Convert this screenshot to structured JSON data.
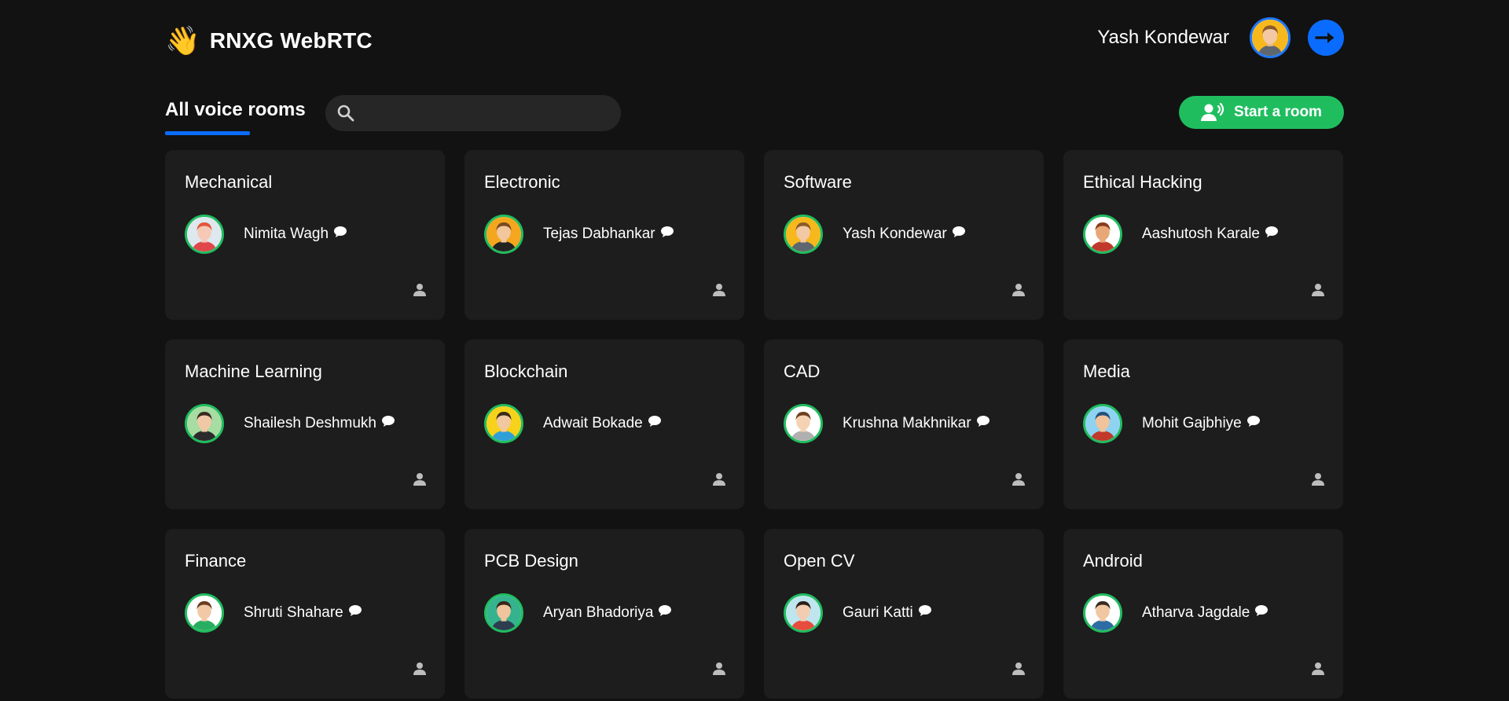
{
  "app": {
    "emoji": "👋",
    "title": "RNXG WebRTC"
  },
  "user": {
    "name": "Yash Kondewar",
    "avatar_icon": "user-avatar-icon"
  },
  "toolbar": {
    "tab_label": "All voice rooms",
    "search_placeholder": "",
    "start_room_label": "Start a room"
  },
  "colors": {
    "accent_blue": "#0a6cff",
    "accent_green": "#20bd5f",
    "card_bg": "#1d1d1d",
    "page_bg": "#121212"
  },
  "rooms": [
    {
      "topic": "Mechanical",
      "speaker": "Nimita Wagh",
      "avatar_bg": "#dfe8ee",
      "hair": "#e2553a",
      "skin": "#f6c9b6",
      "shirt": "#e0474b"
    },
    {
      "topic": "Electronic",
      "speaker": "Tejas Dabhankar",
      "avatar_bg": "#f4a71e",
      "hair": "#7a4a22",
      "skin": "#f2c79e",
      "shirt": "#222222"
    },
    {
      "topic": "Software",
      "speaker": "Yash Kondewar",
      "avatar_bg": "#f6b81c",
      "hair": "#8b5a2b",
      "skin": "#f2c9a4",
      "shirt": "#5e6670"
    },
    {
      "topic": "Ethical Hacking",
      "speaker": "Aashutosh Karale",
      "avatar_bg": "#ffffff",
      "hair": "#8a3b1c",
      "skin": "#e7a777",
      "shirt": "#c0392b"
    },
    {
      "topic": "Machine Learning",
      "speaker": "Shailesh Deshmukh",
      "avatar_bg": "#a7dca2",
      "hair": "#3b2a20",
      "skin": "#f1c8a5",
      "shirt": "#2b2b2b"
    },
    {
      "topic": "Blockchain",
      "speaker": "Adwait Bokade",
      "avatar_bg": "#f7d21a",
      "hair": "#3a2a1c",
      "skin": "#f1c8a0",
      "shirt": "#2f9fd8"
    },
    {
      "topic": "CAD",
      "speaker": "Krushna Makhnikar",
      "avatar_bg": "#ffffff",
      "hair": "#6e3f1f",
      "skin": "#f5d2b3",
      "shirt": "#b0b0b0"
    },
    {
      "topic": "Media",
      "speaker": "Mohit Gajbhiye",
      "avatar_bg": "#8fd3f2",
      "hair": "#24507a",
      "skin": "#f1c39c",
      "shirt": "#c0392b"
    },
    {
      "topic": "Finance",
      "speaker": "Shruti Shahare",
      "avatar_bg": "#ffffff",
      "hair": "#6b3d1f",
      "skin": "#f2c9a6",
      "shirt": "#27ae60"
    },
    {
      "topic": "PCB Design",
      "speaker": "Aryan Bhadoriya",
      "avatar_bg": "#35b38f",
      "hair": "#3a2618",
      "skin": "#f0c49c",
      "shirt": "#2c3e50"
    },
    {
      "topic": "Open CV",
      "speaker": "Gauri Katti",
      "avatar_bg": "#bfe6ee",
      "hair": "#2b1e18",
      "skin": "#f3cdb1",
      "shirt": "#e74c3c"
    },
    {
      "topic": "Android",
      "speaker": "Atharva Jagdale",
      "avatar_bg": "#ffffff",
      "hair": "#3a2a1f",
      "skin": "#f1c7a2",
      "shirt": "#2d6da3"
    }
  ]
}
